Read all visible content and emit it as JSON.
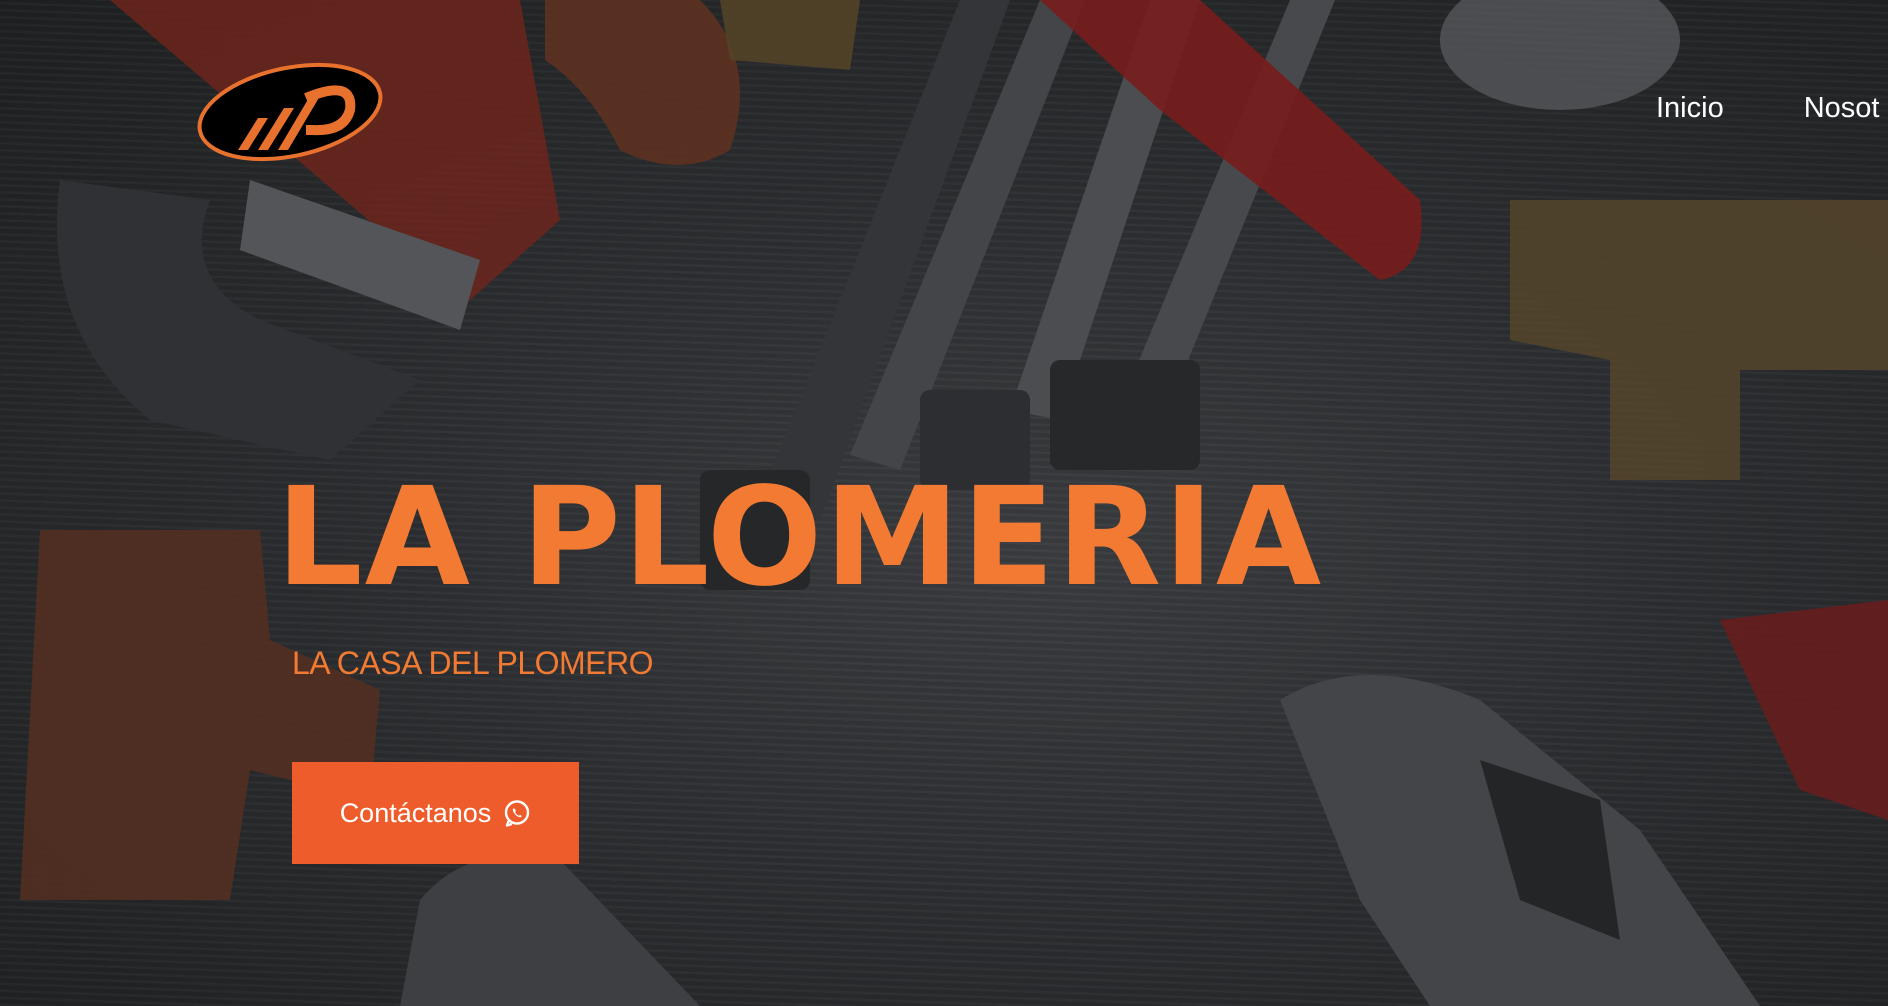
{
  "brand": {
    "logo_icon": "plumbing-logo-icon"
  },
  "nav": {
    "items": [
      {
        "label": "Inicio"
      },
      {
        "label": "Nosot"
      }
    ]
  },
  "hero": {
    "title": "LA PLOMERIA",
    "subtitle": "LA CASA DEL PLOMERO",
    "cta_label": "Contáctanos",
    "cta_icon": "whatsapp-icon"
  },
  "colors": {
    "accent": "#f37a32",
    "button": "#ef5c2b",
    "nav_text": "#ffffff"
  }
}
